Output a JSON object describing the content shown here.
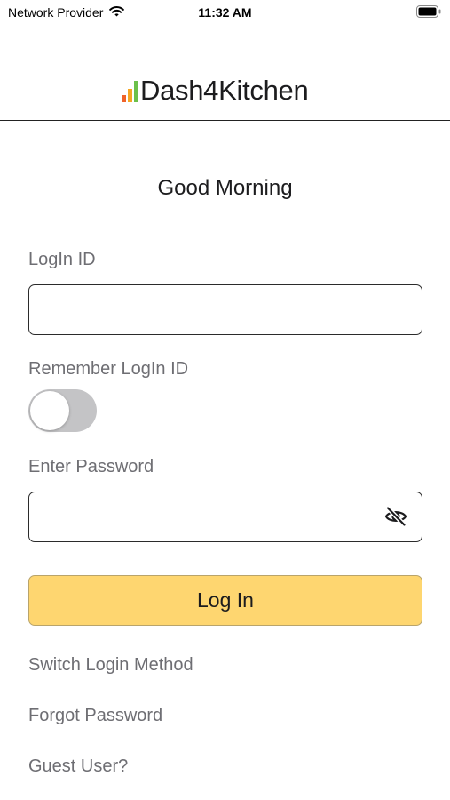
{
  "status_bar": {
    "carrier": "Network Provider",
    "time": "11:32 AM"
  },
  "app": {
    "name": "Dash4Kitchen",
    "logo_bar_colors": [
      "#f0632a",
      "#f5a623",
      "#6cc04a"
    ]
  },
  "greeting": "Good Morning",
  "login_form": {
    "login_id_label": "LogIn ID",
    "login_id_value": "",
    "remember_label": "Remember LogIn ID",
    "remember_enabled": false,
    "password_label": "Enter Password",
    "password_value": "",
    "submit_label": "Log In"
  },
  "links": {
    "switch_method": "Switch Login Method",
    "forgot_password": "Forgot Password",
    "guest_user": "Guest User?"
  },
  "colors": {
    "accent": "#fed670",
    "label_gray": "#6e6e73",
    "toggle_off": "#c4c4c6"
  },
  "icons": {
    "wifi": "wifi-icon",
    "battery": "battery-icon",
    "password_visibility": "eye-slash-icon"
  }
}
